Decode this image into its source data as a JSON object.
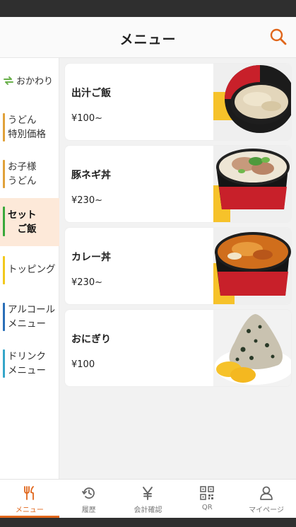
{
  "header": {
    "title": "メニュー",
    "search_icon": "search-icon"
  },
  "colors": {
    "accent": "#e0661b",
    "active_category_bg": "#fde9d9",
    "refill_green": "#6ab04c"
  },
  "sidebar": {
    "refill_label": "おかわり",
    "categories": [
      {
        "label": "うどん\n特別価格",
        "bar_color": "#e0a13a",
        "active": false
      },
      {
        "label": "お子様\nうどん",
        "bar_color": "#e0a13a",
        "active": false
      },
      {
        "label": "セット\n　ご飯",
        "bar_color": "#3aa83a",
        "active": true
      },
      {
        "label": "トッピング",
        "bar_color": "#f2c81c",
        "active": false
      },
      {
        "label": "アルコール\nメニュー",
        "bar_color": "#2a6fb8",
        "active": false
      },
      {
        "label": "ドリンク\nメニュー",
        "bar_color": "#35a6c9",
        "active": false
      }
    ]
  },
  "items": [
    {
      "name": "出汁ご飯",
      "price": "¥100~"
    },
    {
      "name": "豚ネギ丼",
      "price": "¥230~"
    },
    {
      "name": "カレー丼",
      "price": "¥230~"
    },
    {
      "name": "おにぎり",
      "price": "¥100"
    }
  ],
  "tabs": [
    {
      "label": "メニュー",
      "icon": "fork-knife-icon",
      "active": true
    },
    {
      "label": "履歴",
      "icon": "history-icon",
      "active": false
    },
    {
      "label": "会計確認",
      "icon": "yen-icon",
      "active": false
    },
    {
      "label": "QR",
      "icon": "qr-code-icon",
      "active": false
    },
    {
      "label": "マイページ",
      "icon": "person-icon",
      "active": false
    }
  ]
}
